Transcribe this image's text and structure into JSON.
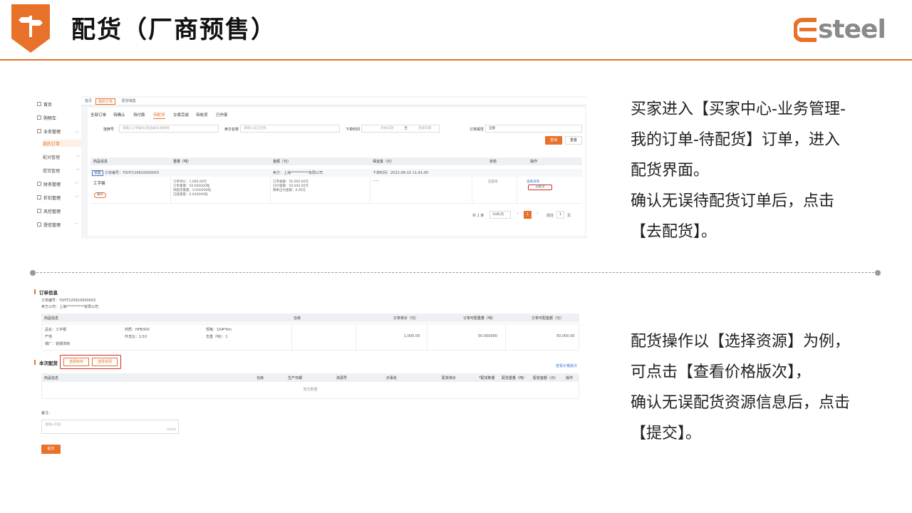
{
  "slide": {
    "title": "配货（厂商预售）",
    "logo_text": "steel",
    "accent": "#e8722a"
  },
  "shot1": {
    "sidebar": {
      "items": [
        {
          "label": "首页",
          "icon": "home-icon"
        },
        {
          "label": "购物车",
          "icon": "cart-icon"
        },
        {
          "label": "业务管理",
          "icon": "briefcase-icon"
        },
        {
          "label": "我的订单",
          "icon": ""
        },
        {
          "label": "配对管理",
          "icon": ""
        },
        {
          "label": "提货管理",
          "icon": ""
        },
        {
          "label": "财务管理",
          "icon": "wallet-icon"
        },
        {
          "label": "折扣管理",
          "icon": "discount-icon"
        },
        {
          "label": "风控管理",
          "icon": "shield-icon"
        },
        {
          "label": "授信管理",
          "icon": "credit-icon"
        }
      ]
    },
    "top_tabs": [
      "首页",
      "我的订单",
      "配货销售"
    ],
    "sub_tabs": [
      "全部订单",
      "待确认",
      "待付款",
      "待配货",
      "交易完成",
      "待收货",
      "已作废"
    ],
    "filters": {
      "order_no_label": "挂牌号",
      "order_no_placeholder": "请输入订单编号/商品编号/规格等",
      "seller_label": "卖方名称",
      "seller_placeholder": "请输入卖方名称",
      "time_label": "下单时间",
      "start_placeholder": "开始日期",
      "to": "至",
      "end_placeholder": "结束日期",
      "attr_label": "订单属性",
      "attr_value": "全部",
      "search_btn": "查询",
      "reset_btn": "重置"
    },
    "table_headers": [
      "商品信息",
      "重量（吨）",
      "金额（元）",
      "保证金（元）",
      "状态",
      "操作"
    ],
    "order": {
      "tag": "预售",
      "order_no": "订单编号：YSHT220810000003",
      "seller": "卖方：上海**********有限公司",
      "time": "下单时间：2022-08-10 11:41:00",
      "product": "工字钢",
      "expand": "展开",
      "weights": [
        "订单单价：1,000.00元",
        "订单重量：50.000000吨",
        "待配货重量：0.000000吨",
        "已配重量：0.000000吨"
      ],
      "amounts": [
        "订单金额：50,000.00元",
        "已付金额：50,000.00元",
        "剩余应付金额：0.00元"
      ],
      "deposit": "——",
      "status": "已支付",
      "op_view": "查看详情",
      "op_allocate": "去配货"
    },
    "pagination": {
      "total": "共 1 条",
      "page_size": "10条/页",
      "prev": "‹",
      "current": "1",
      "next": "›",
      "goto_label": "前往",
      "goto_value": "1",
      "page_unit": "页"
    }
  },
  "desc1": [
    "买家进入【买家中心-业务管理-",
    "我的订单-待配货】订单，进入",
    "配货界面。",
    "确认无误待配货订单后，点击",
    "【去配货】。"
  ],
  "shot2": {
    "order_info_title": "订单信息",
    "order_no": "订单编号：YSHT220810000003",
    "seller": "卖方公司：上海**********有限公司",
    "headers1": [
      "商品信息",
      "仓库",
      "订单单价（元）",
      "订单可配重量（吨）",
      "订单可配金额（元）"
    ],
    "product": {
      "name": "品名：工字钢",
      "material": "材质：HPB300",
      "spec": "规格：10#*6m",
      "origin": "产地",
      "pieces": "件支比：1/10",
      "pieces_weight": "支重（吨）：1",
      "factory": "钢厂：首钢滦南",
      "price": "1,000.00",
      "weight": "50.000000",
      "amount": "50,000.00"
    },
    "alloc_title": "本次配货",
    "btn_select_stock": "选择库存",
    "btn_select_resource": "选择资源",
    "link_price_version": "查看价格版次",
    "headers2": [
      "商品信息",
      "仓库",
      "生产日期",
      "资源号",
      "办事处",
      "配货单价",
      "*配货数量",
      "配货重量（吨）",
      "配货金额（元）",
      "操作"
    ],
    "empty": "暂无数据",
    "note_label": "备注：",
    "note_placeholder": "请输入内容",
    "note_counter": "0/200",
    "submit": "提交"
  },
  "desc2": [
    "配货操作以【选择资源】为例，",
    "可点击【查看价格版次】，",
    "确认无误配货资源信息后，点击",
    "【提交】。"
  ]
}
